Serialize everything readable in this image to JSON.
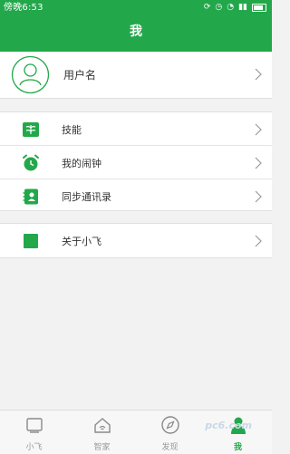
{
  "status_bar": {
    "time": "傍晚6:53"
  },
  "header": {
    "title": "我"
  },
  "profile": {
    "username": "用户名"
  },
  "menu": {
    "group1": [
      {
        "label": "技能",
        "icon": "skill-book-icon"
      },
      {
        "label": "我的闹钟",
        "icon": "alarm-clock-icon"
      },
      {
        "label": "同步通讯录",
        "icon": "contacts-icon"
      }
    ],
    "group2": [
      {
        "label": "关于小飞",
        "icon": "about-square-icon"
      }
    ]
  },
  "tabbar": {
    "tabs": [
      {
        "label": "小飞",
        "icon": "screen-icon"
      },
      {
        "label": "智家",
        "icon": "smart-home-icon"
      },
      {
        "label": "发现",
        "icon": "compass-icon"
      },
      {
        "label": "我",
        "icon": "person-icon",
        "active": true
      }
    ]
  },
  "colors": {
    "primary": "#22a84a",
    "background": "#f2f2f2",
    "text": "#333333",
    "muted": "#999999"
  },
  "watermark": "pc6.com"
}
